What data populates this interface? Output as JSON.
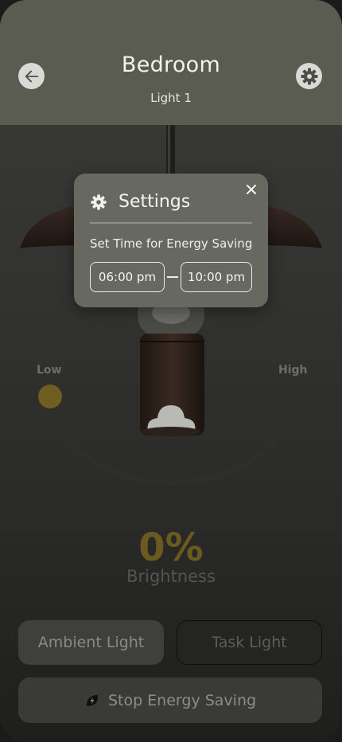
{
  "header": {
    "title": "Bedroom",
    "subtitle": "Light 1",
    "back_icon": "arrow-left-icon",
    "settings_icon": "gear-icon"
  },
  "dial": {
    "low_label": "Low",
    "high_label": "High",
    "level": 0
  },
  "brightness": {
    "value": "0%",
    "label": "Brightness"
  },
  "modes": {
    "ambient_label": "Ambient Light",
    "task_label": "Task Light"
  },
  "energy": {
    "button_label": "Stop Energy Saving",
    "icon": "leaf-bolt-icon"
  },
  "settings_popup": {
    "title": "Settings",
    "subtitle": "Set Time for Energy Saving",
    "start_time": "06:00 pm",
    "end_time": "10:00 pm",
    "close_icon": "close-icon"
  },
  "colors": {
    "header_bg": "#5a5c51",
    "accent": "#6f5e1f",
    "popup_bg": "#676860"
  }
}
